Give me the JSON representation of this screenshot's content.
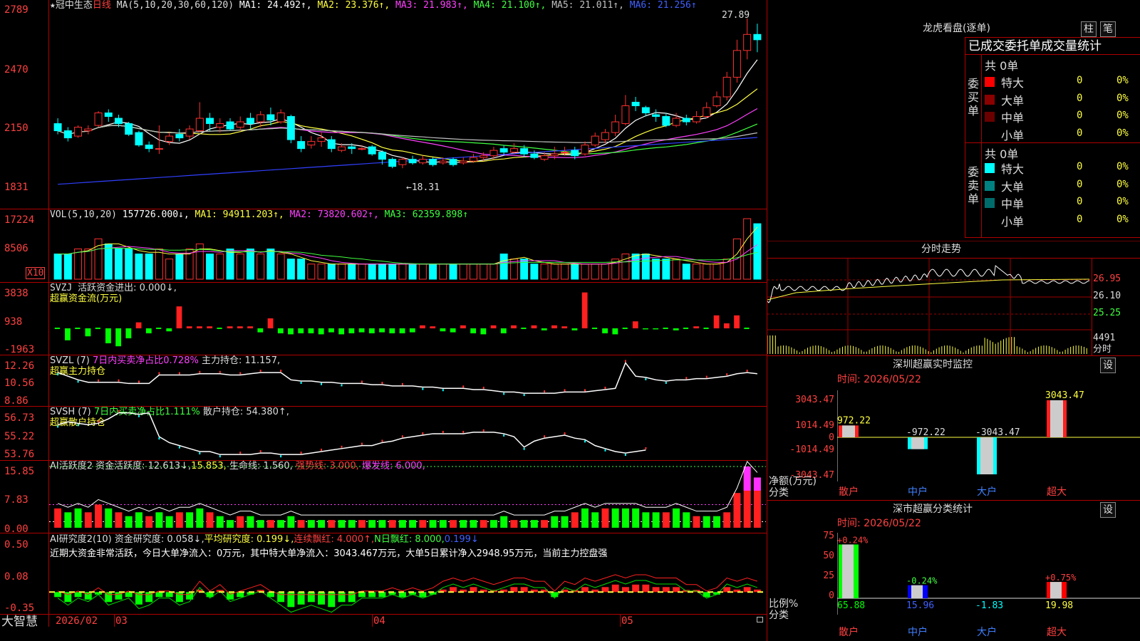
{
  "stock": {
    "name": "冠中生态",
    "period": "日线",
    "star": "★"
  },
  "ma_legend": [
    {
      "text": "MA(5,10,20,30,60,120)",
      "color": "#dddddd"
    },
    {
      "text": "MA1: 24.492↑,",
      "color": "#ffffff"
    },
    {
      "text": "MA2: 23.376↑,",
      "color": "#ffff40"
    },
    {
      "text": "MA3: 21.983↑,",
      "color": "#ff40ff"
    },
    {
      "text": "MA4: 21.100↑,",
      "color": "#40ff40"
    },
    {
      "text": "MA5: 21.011↑,",
      "color": "#c0c0c0"
    },
    {
      "text": "MA6: 21.256↑",
      "color": "#4060ff"
    }
  ],
  "price_axis": [
    "2789",
    "2470",
    "2150",
    "1831"
  ],
  "price_high_label": "27.89",
  "price_low_label": "←18.31",
  "vol_legend": [
    {
      "text": "VOL(5,10,20)",
      "color": "#dddddd"
    },
    {
      "text": "157726.000↓,",
      "color": "#ffffff"
    },
    {
      "text": "MA1: 94911.203↑,",
      "color": "#ffff40"
    },
    {
      "text": "MA2: 73820.602↑,",
      "color": "#ff40ff"
    },
    {
      "text": "MA3: 62359.898↑",
      "color": "#40ff40"
    }
  ],
  "vol_axis": [
    "17224",
    "8506"
  ],
  "vol_unit": "X10",
  "svzj": {
    "name": "SVZJ",
    "desc": "活跃资金进出: 0.000↓,",
    "sub": "超赢资金流(万元)",
    "axis": [
      "3838",
      "938",
      "-1963"
    ]
  },
  "svzl": {
    "name": "SVZL (7)",
    "desc": "7日内买卖净占比0.728%",
    "desc2": "主力持仓: 11.157,",
    "sub": "超赢主力持仓",
    "axis": [
      "12.26",
      "10.56",
      "8.86"
    ]
  },
  "svsh": {
    "name": "SVSH (7)",
    "desc": "7日内买卖净占比1.111%",
    "desc2": "散户持仓: 54.380↑,",
    "sub": "超赢散户持仓",
    "axis": [
      "56.73",
      "55.22",
      "53.76"
    ]
  },
  "ai_active": {
    "name": "AI活跃度2",
    "desc": "资金活跃度: 12.613↓,",
    "v2": "15.853,",
    "v3": "生命线: 1.560,",
    "v4": "强势线: 3.000,",
    "v5": "爆发线: 6.000,",
    "axis": [
      "15.85",
      "7.83",
      "0.00"
    ]
  },
  "ai_research": {
    "name": "AI研究度2(10)",
    "desc": "资金研究度: 0.058↓,",
    "v2": "平均研究度: 0.199↓,",
    "v3": "连续飘红: 4.000↑,",
    "v4": "N日飘红: 8.000,",
    "v5": "0.199↓",
    "note": "近期大资金非常活跃，今日大单净流入：0万元，其中特大单净流入：3043.467万元，大单5日累计净入2948.95万元，当前主力控盘强",
    "axis": [
      "0.50",
      "0.08",
      "-0.35"
    ]
  },
  "date_axis": {
    "brand": "大智慧",
    "labels": [
      "2026/02",
      "03",
      "04",
      "05"
    ]
  },
  "right": {
    "lhb_title": "龙虎看盘(逐单)",
    "tab1": "柱",
    "tab2": "笔",
    "stats_title": "已成交委托单成交量统计",
    "buy_label": "委买单",
    "sell_label": "委卖单",
    "buy_total": "共 0单",
    "sell_total": "共 0单",
    "buy_rows": [
      {
        "label": "特大",
        "count": "0",
        "pct": "0%",
        "color": "#ff0000"
      },
      {
        "label": "大单",
        "count": "0",
        "pct": "0%",
        "color": "#8b0000"
      },
      {
        "label": "中单",
        "count": "0",
        "pct": "0%",
        "color": "#6a0000"
      },
      {
        "label": "小单",
        "count": "0",
        "pct": "0%",
        "color": ""
      }
    ],
    "sell_rows": [
      {
        "label": "特大",
        "count": "0",
        "pct": "0%",
        "color": "#00ffff"
      },
      {
        "label": "大单",
        "count": "0",
        "pct": "0%",
        "color": "#008080"
      },
      {
        "label": "中单",
        "count": "0",
        "pct": "0%",
        "color": "#006b6b"
      },
      {
        "label": "小单",
        "count": "0",
        "pct": "0%",
        "color": ""
      }
    ],
    "intraday_title": "分时走势",
    "intraday_axis": [
      "26.95",
      "26.10",
      "25.25"
    ],
    "intraday_vol": "4491",
    "intraday_vol_unit": "分时",
    "monitor_title": "深圳超赢实时监控",
    "monitor_set": "设",
    "monitor_time": "时间: 2026/05/22",
    "monitor_axis": [
      "3043.47",
      "1014.49",
      "0",
      "-1014.49",
      "-3043.47"
    ],
    "monitor_unit": "净额(万元)",
    "monitor_unit2": "分类",
    "monitor_bars": [
      {
        "cat": "散户",
        "value": 972.22,
        "label": "972.22"
      },
      {
        "cat": "中户",
        "value": -972.22,
        "label": "-972.22"
      },
      {
        "cat": "大户",
        "value": -3043.47,
        "label": "-3043.47"
      },
      {
        "cat": "超大",
        "value": 3043.47,
        "label": "3043.47"
      }
    ],
    "class_title": "深市超赢分类统计",
    "class_set": "设",
    "class_time": "时间: 2026/05/22",
    "class_axis": [
      "75",
      "50",
      "25",
      "0"
    ],
    "class_unit": "比例%",
    "class_unit2": "分类",
    "class_bars": [
      {
        "cat": "散户",
        "value": 65.88,
        "change": "+0.24%",
        "label": "65.88",
        "color": "#00ff00",
        "lbl": "#00ff00"
      },
      {
        "cat": "中户",
        "value": 15.96,
        "change": "-0.24%",
        "label": "15.96",
        "color": "#0000ff",
        "lbl": "#4060ff"
      },
      {
        "cat": "大户",
        "value": 0,
        "change": "",
        "label": "-1.83",
        "color": "#00ffff",
        "lbl": "#00ffff"
      },
      {
        "cat": "超大",
        "value": 19.98,
        "change": "+0.75%",
        "label": "19.98",
        "color": "#ff0000",
        "lbl": "#ffff40"
      }
    ]
  },
  "chart_data": {
    "type": "candlestick",
    "series": [
      {
        "name": "K",
        "candles": [
          [
            22.0,
            21.6,
            22.3,
            21.4
          ],
          [
            21.6,
            21.2,
            21.8,
            21.0
          ],
          [
            21.3,
            21.8,
            21.9,
            21.2
          ],
          [
            21.6,
            21.7,
            21.9,
            21.4
          ],
          [
            21.9,
            22.6,
            22.7,
            21.8
          ],
          [
            22.6,
            22.4,
            22.8,
            22.1
          ],
          [
            22.3,
            22.0,
            22.5,
            21.8
          ],
          [
            22.0,
            21.4,
            22.1,
            21.3
          ],
          [
            21.5,
            20.8,
            21.6,
            20.7
          ],
          [
            20.8,
            20.6,
            21.0,
            20.4
          ],
          [
            20.6,
            20.6,
            21.9,
            20.3
          ],
          [
            21.0,
            21.3,
            21.5,
            20.8
          ],
          [
            21.4,
            21.2,
            21.7,
            21.0
          ],
          [
            21.3,
            21.7,
            21.9,
            21.1
          ],
          [
            21.6,
            22.3,
            23.2,
            21.5
          ],
          [
            22.3,
            22.0,
            22.6,
            21.6
          ],
          [
            21.8,
            22.0,
            22.3,
            21.5
          ],
          [
            22.1,
            21.7,
            22.3,
            21.6
          ],
          [
            21.8,
            22.1,
            22.4,
            21.6
          ],
          [
            22.3,
            22.0,
            22.6,
            21.7
          ],
          [
            22.1,
            22.5,
            22.7,
            21.8
          ],
          [
            22.5,
            22.2,
            22.9,
            21.9
          ],
          [
            22.1,
            22.6,
            22.8,
            22.0
          ],
          [
            22.4,
            21.1,
            22.5,
            20.9
          ],
          [
            21.0,
            20.6,
            21.3,
            20.4
          ],
          [
            20.8,
            21.0,
            21.3,
            20.6
          ],
          [
            21.0,
            21.2,
            21.5,
            20.7
          ],
          [
            21.1,
            20.6,
            21.3,
            20.4
          ],
          [
            20.5,
            20.7,
            20.9,
            20.4
          ],
          [
            20.7,
            20.6,
            20.9,
            20.3
          ],
          [
            20.6,
            20.6,
            20.8,
            20.5
          ],
          [
            20.7,
            20.3,
            20.8,
            20.2
          ],
          [
            20.4,
            20.0,
            20.5,
            19.7
          ],
          [
            20.0,
            19.6,
            20.1,
            19.5
          ],
          [
            19.7,
            20.0,
            20.1,
            19.5
          ],
          [
            20.0,
            19.8,
            20.2,
            19.7
          ],
          [
            19.8,
            20.0,
            20.2,
            19.7
          ],
          [
            20.0,
            19.7,
            20.1,
            19.6
          ],
          [
            19.8,
            19.9,
            20.1,
            19.7
          ],
          [
            20.0,
            19.7,
            20.1,
            19.6
          ],
          [
            19.8,
            19.9,
            20.1,
            19.7
          ],
          [
            19.9,
            20.1,
            20.3,
            19.8
          ],
          [
            20.1,
            20.2,
            20.4,
            19.9
          ],
          [
            20.2,
            20.5,
            20.7,
            20.0
          ],
          [
            20.6,
            20.4,
            20.8,
            20.2
          ],
          [
            20.4,
            20.6,
            20.9,
            20.3
          ],
          [
            20.6,
            20.3,
            20.8,
            20.1
          ],
          [
            20.3,
            20.1,
            20.5,
            20.0
          ],
          [
            20.0,
            20.2,
            20.4,
            19.9
          ],
          [
            20.2,
            20.3,
            20.7,
            20.0
          ],
          [
            20.4,
            20.4,
            20.7,
            20.2
          ],
          [
            20.5,
            20.2,
            20.7,
            20.0
          ],
          [
            20.3,
            20.8,
            21.0,
            20.2
          ],
          [
            20.8,
            21.3,
            21.5,
            20.7
          ],
          [
            21.1,
            21.5,
            21.7,
            20.9
          ],
          [
            21.5,
            22.1,
            22.5,
            21.3
          ],
          [
            22.0,
            23.0,
            23.6,
            21.9
          ],
          [
            23.2,
            23.0,
            23.5,
            22.7
          ],
          [
            22.9,
            22.6,
            23.0,
            22.4
          ],
          [
            22.5,
            22.4,
            22.8,
            22.1
          ],
          [
            22.4,
            21.9,
            22.6,
            21.8
          ],
          [
            21.9,
            22.3,
            22.6,
            21.8
          ],
          [
            22.3,
            22.1,
            22.5,
            21.9
          ],
          [
            22.1,
            22.4,
            22.7,
            22.0
          ],
          [
            22.4,
            22.9,
            23.2,
            22.3
          ],
          [
            23.0,
            23.5,
            23.8,
            22.9
          ],
          [
            23.5,
            24.6,
            24.9,
            23.3
          ],
          [
            24.6,
            26.1,
            26.7,
            24.3
          ],
          [
            26.1,
            27.0,
            27.89,
            25.6
          ],
          [
            27.0,
            26.7,
            27.6,
            26.0
          ]
        ]
      }
    ]
  }
}
